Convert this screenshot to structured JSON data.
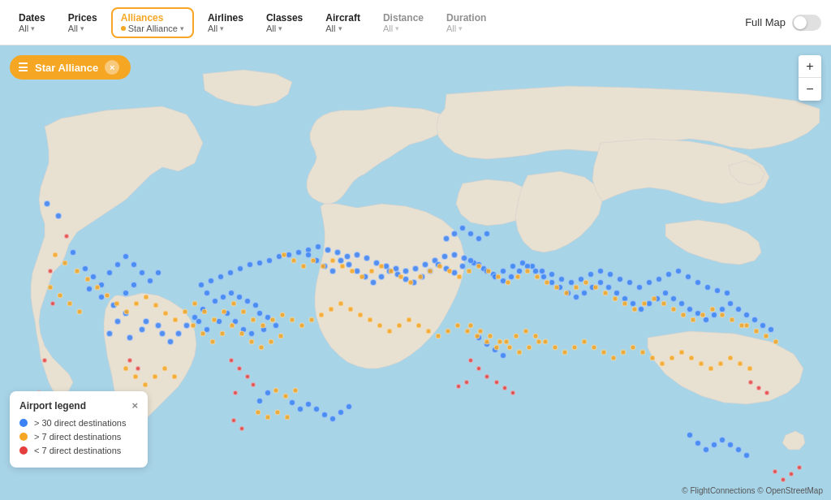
{
  "header": {
    "filters": [
      {
        "id": "dates",
        "label": "Dates",
        "value": "All",
        "active": false
      },
      {
        "id": "prices",
        "label": "Prices",
        "value": "All",
        "active": false
      },
      {
        "id": "alliances",
        "label": "Alliances",
        "value": "Star Alliance",
        "active": true,
        "has_dot": true
      },
      {
        "id": "airlines",
        "label": "Airlines",
        "value": "All",
        "active": false
      },
      {
        "id": "classes",
        "label": "Classes",
        "value": "All",
        "active": false
      },
      {
        "id": "aircraft",
        "label": "Aircraft",
        "value": "All",
        "active": false
      },
      {
        "id": "distance",
        "label": "Distance",
        "value": "All",
        "active": false,
        "muted": true
      },
      {
        "id": "duration",
        "label": "Duration",
        "value": "All",
        "active": false,
        "muted": true
      }
    ],
    "fullmap_label": "Full Map"
  },
  "filter_chip": {
    "label": "Star Alliance",
    "close_label": "×"
  },
  "zoom": {
    "plus": "+",
    "minus": "−"
  },
  "legend": {
    "title": "Airport legend",
    "close": "×",
    "items": [
      {
        "color": "#3b82f6",
        "text": "> 30 direct destinations"
      },
      {
        "color": "#f5a623",
        "text": "> 7 direct destinations"
      },
      {
        "color": "#e53e3e",
        "text": "< 7 direct destinations"
      }
    ]
  },
  "attribution": "© FlightConnections © OpenStreetMap",
  "dots": {
    "blue": [
      [
        72,
        210
      ],
      [
        58,
        195
      ],
      [
        90,
        255
      ],
      [
        110,
        300
      ],
      [
        125,
        310
      ],
      [
        140,
        320
      ],
      [
        155,
        305
      ],
      [
        165,
        295
      ],
      [
        155,
        330
      ],
      [
        145,
        340
      ],
      [
        135,
        355
      ],
      [
        160,
        360
      ],
      [
        175,
        350
      ],
      [
        180,
        340
      ],
      [
        195,
        345
      ],
      [
        200,
        355
      ],
      [
        210,
        365
      ],
      [
        220,
        355
      ],
      [
        230,
        345
      ],
      [
        240,
        335
      ],
      [
        250,
        325
      ],
      [
        245,
        340
      ],
      [
        255,
        350
      ],
      [
        270,
        340
      ],
      [
        280,
        330
      ],
      [
        290,
        340
      ],
      [
        300,
        350
      ],
      [
        310,
        355
      ],
      [
        325,
        350
      ],
      [
        340,
        345
      ],
      [
        330,
        335
      ],
      [
        320,
        330
      ],
      [
        315,
        320
      ],
      [
        305,
        315
      ],
      [
        295,
        310
      ],
      [
        285,
        305
      ],
      [
        275,
        310
      ],
      [
        265,
        315
      ],
      [
        255,
        305
      ],
      [
        248,
        295
      ],
      [
        260,
        290
      ],
      [
        272,
        285
      ],
      [
        284,
        280
      ],
      [
        296,
        275
      ],
      [
        308,
        270
      ],
      [
        320,
        268
      ],
      [
        332,
        265
      ],
      [
        344,
        260
      ],
      [
        356,
        258
      ],
      [
        368,
        255
      ],
      [
        380,
        252
      ],
      [
        392,
        248
      ],
      [
        404,
        252
      ],
      [
        416,
        255
      ],
      [
        428,
        260
      ],
      [
        440,
        258
      ],
      [
        452,
        262
      ],
      [
        464,
        268
      ],
      [
        476,
        272
      ],
      [
        488,
        275
      ],
      [
        500,
        278
      ],
      [
        512,
        275
      ],
      [
        524,
        270
      ],
      [
        536,
        265
      ],
      [
        548,
        260
      ],
      [
        560,
        258
      ],
      [
        572,
        262
      ],
      [
        584,
        268
      ],
      [
        596,
        275
      ],
      [
        608,
        282
      ],
      [
        620,
        278
      ],
      [
        632,
        272
      ],
      [
        644,
        268
      ],
      [
        656,
        272
      ],
      [
        668,
        278
      ],
      [
        680,
        282
      ],
      [
        692,
        288
      ],
      [
        704,
        292
      ],
      [
        716,
        288
      ],
      [
        728,
        282
      ],
      [
        740,
        278
      ],
      [
        752,
        282
      ],
      [
        764,
        288
      ],
      [
        776,
        292
      ],
      [
        788,
        298
      ],
      [
        800,
        292
      ],
      [
        812,
        288
      ],
      [
        824,
        282
      ],
      [
        836,
        278
      ],
      [
        848,
        285
      ],
      [
        860,
        292
      ],
      [
        872,
        298
      ],
      [
        884,
        302
      ],
      [
        896,
        305
      ],
      [
        380,
        258
      ],
      [
        390,
        265
      ],
      [
        400,
        272
      ],
      [
        410,
        278
      ],
      [
        420,
        265
      ],
      [
        430,
        270
      ],
      [
        440,
        278
      ],
      [
        450,
        285
      ],
      [
        460,
        292
      ],
      [
        470,
        285
      ],
      [
        480,
        278
      ],
      [
        490,
        282
      ],
      [
        500,
        288
      ],
      [
        510,
        292
      ],
      [
        520,
        285
      ],
      [
        530,
        278
      ],
      [
        540,
        270
      ],
      [
        550,
        275
      ],
      [
        560,
        280
      ],
      [
        570,
        272
      ],
      [
        580,
        265
      ],
      [
        590,
        270
      ],
      [
        600,
        278
      ],
      [
        610,
        285
      ],
      [
        620,
        290
      ],
      [
        630,
        285
      ],
      [
        640,
        278
      ],
      [
        650,
        272
      ],
      [
        660,
        278
      ],
      [
        670,
        285
      ],
      [
        680,
        292
      ],
      [
        690,
        298
      ],
      [
        700,
        305
      ],
      [
        710,
        310
      ],
      [
        720,
        305
      ],
      [
        730,
        298
      ],
      [
        740,
        292
      ],
      [
        750,
        298
      ],
      [
        760,
        305
      ],
      [
        770,
        312
      ],
      [
        780,
        318
      ],
      [
        790,
        325
      ],
      [
        800,
        318
      ],
      [
        810,
        312
      ],
      [
        820,
        305
      ],
      [
        830,
        312
      ],
      [
        840,
        318
      ],
      [
        850,
        325
      ],
      [
        860,
        330
      ],
      [
        870,
        338
      ],
      [
        880,
        332
      ],
      [
        890,
        325
      ],
      [
        900,
        318
      ],
      [
        910,
        325
      ],
      [
        920,
        332
      ],
      [
        930,
        338
      ],
      [
        940,
        345
      ],
      [
        950,
        350
      ],
      [
        590,
        360
      ],
      [
        600,
        368
      ],
      [
        610,
        375
      ],
      [
        620,
        382
      ],
      [
        330,
        428
      ],
      [
        320,
        438
      ],
      [
        360,
        440
      ],
      [
        370,
        448
      ],
      [
        380,
        442
      ],
      [
        390,
        448
      ],
      [
        400,
        455
      ],
      [
        410,
        460
      ],
      [
        420,
        452
      ],
      [
        430,
        445
      ],
      [
        105,
        275
      ],
      [
        115,
        285
      ],
      [
        125,
        295
      ],
      [
        135,
        280
      ],
      [
        145,
        270
      ],
      [
        155,
        260
      ],
      [
        165,
        270
      ],
      [
        175,
        280
      ],
      [
        185,
        290
      ],
      [
        195,
        280
      ],
      [
        850,
        480
      ],
      [
        860,
        490
      ],
      [
        870,
        498
      ],
      [
        880,
        492
      ],
      [
        890,
        486
      ],
      [
        900,
        492
      ],
      [
        910,
        498
      ],
      [
        920,
        505
      ],
      [
        550,
        238
      ],
      [
        560,
        232
      ],
      [
        570,
        225
      ],
      [
        580,
        232
      ],
      [
        590,
        238
      ],
      [
        600,
        232
      ]
    ],
    "orange": [
      [
        68,
        258
      ],
      [
        80,
        268
      ],
      [
        95,
        278
      ],
      [
        108,
        288
      ],
      [
        120,
        298
      ],
      [
        132,
        308
      ],
      [
        144,
        318
      ],
      [
        156,
        328
      ],
      [
        168,
        318
      ],
      [
        180,
        310
      ],
      [
        192,
        320
      ],
      [
        204,
        330
      ],
      [
        216,
        338
      ],
      [
        228,
        328
      ],
      [
        240,
        318
      ],
      [
        252,
        328
      ],
      [
        264,
        338
      ],
      [
        276,
        328
      ],
      [
        288,
        318
      ],
      [
        300,
        328
      ],
      [
        312,
        338
      ],
      [
        324,
        345
      ],
      [
        336,
        338
      ],
      [
        348,
        332
      ],
      [
        360,
        338
      ],
      [
        372,
        345
      ],
      [
        384,
        338
      ],
      [
        396,
        332
      ],
      [
        408,
        325
      ],
      [
        420,
        318
      ],
      [
        432,
        325
      ],
      [
        444,
        332
      ],
      [
        456,
        338
      ],
      [
        468,
        345
      ],
      [
        480,
        352
      ],
      [
        492,
        345
      ],
      [
        504,
        338
      ],
      [
        516,
        345
      ],
      [
        528,
        352
      ],
      [
        540,
        358
      ],
      [
        552,
        352
      ],
      [
        564,
        345
      ],
      [
        576,
        352
      ],
      [
        588,
        358
      ],
      [
        600,
        365
      ],
      [
        612,
        372
      ],
      [
        624,
        365
      ],
      [
        636,
        358
      ],
      [
        648,
        352
      ],
      [
        660,
        358
      ],
      [
        672,
        365
      ],
      [
        684,
        372
      ],
      [
        696,
        378
      ],
      [
        708,
        372
      ],
      [
        720,
        365
      ],
      [
        732,
        372
      ],
      [
        744,
        378
      ],
      [
        756,
        385
      ],
      [
        768,
        378
      ],
      [
        780,
        372
      ],
      [
        792,
        378
      ],
      [
        804,
        385
      ],
      [
        816,
        392
      ],
      [
        828,
        385
      ],
      [
        840,
        378
      ],
      [
        852,
        385
      ],
      [
        864,
        392
      ],
      [
        876,
        398
      ],
      [
        888,
        392
      ],
      [
        900,
        385
      ],
      [
        912,
        392
      ],
      [
        924,
        398
      ],
      [
        350,
        258
      ],
      [
        362,
        265
      ],
      [
        374,
        272
      ],
      [
        386,
        265
      ],
      [
        398,
        272
      ],
      [
        410,
        265
      ],
      [
        422,
        272
      ],
      [
        434,
        278
      ],
      [
        446,
        285
      ],
      [
        458,
        278
      ],
      [
        470,
        272
      ],
      [
        482,
        278
      ],
      [
        494,
        285
      ],
      [
        506,
        292
      ],
      [
        518,
        285
      ],
      [
        530,
        278
      ],
      [
        542,
        272
      ],
      [
        554,
        278
      ],
      [
        566,
        285
      ],
      [
        578,
        278
      ],
      [
        590,
        272
      ],
      [
        602,
        278
      ],
      [
        614,
        285
      ],
      [
        626,
        292
      ],
      [
        638,
        285
      ],
      [
        650,
        278
      ],
      [
        662,
        285
      ],
      [
        674,
        292
      ],
      [
        686,
        298
      ],
      [
        698,
        305
      ],
      [
        710,
        298
      ],
      [
        722,
        292
      ],
      [
        734,
        298
      ],
      [
        746,
        305
      ],
      [
        758,
        312
      ],
      [
        770,
        318
      ],
      [
        782,
        325
      ],
      [
        794,
        318
      ],
      [
        806,
        312
      ],
      [
        818,
        318
      ],
      [
        830,
        325
      ],
      [
        842,
        332
      ],
      [
        854,
        338
      ],
      [
        866,
        332
      ],
      [
        878,
        325
      ],
      [
        890,
        332
      ],
      [
        902,
        338
      ],
      [
        914,
        345
      ],
      [
        62,
        298
      ],
      [
        74,
        308
      ],
      [
        86,
        318
      ],
      [
        98,
        328
      ],
      [
        238,
        345
      ],
      [
        250,
        355
      ],
      [
        262,
        365
      ],
      [
        274,
        355
      ],
      [
        286,
        345
      ],
      [
        298,
        355
      ],
      [
        310,
        365
      ],
      [
        322,
        372
      ],
      [
        334,
        365
      ],
      [
        346,
        358
      ],
      [
        155,
        398
      ],
      [
        167,
        408
      ],
      [
        179,
        418
      ],
      [
        191,
        408
      ],
      [
        203,
        398
      ],
      [
        215,
        408
      ],
      [
        318,
        452
      ],
      [
        330,
        458
      ],
      [
        342,
        452
      ],
      [
        354,
        458
      ],
      [
        920,
        345
      ],
      [
        932,
        352
      ],
      [
        944,
        358
      ],
      [
        956,
        365
      ],
      [
        580,
        345
      ],
      [
        592,
        352
      ],
      [
        604,
        358
      ],
      [
        616,
        365
      ],
      [
        628,
        372
      ],
      [
        640,
        378
      ],
      [
        652,
        372
      ],
      [
        664,
        365
      ],
      [
        340,
        425
      ],
      [
        352,
        432
      ],
      [
        364,
        425
      ]
    ],
    "red": [
      [
        82,
        235
      ],
      [
        62,
        278
      ],
      [
        55,
        388
      ],
      [
        48,
        428
      ],
      [
        45,
        498
      ],
      [
        58,
        508
      ],
      [
        285,
        388
      ],
      [
        295,
        398
      ],
      [
        305,
        408
      ],
      [
        312,
        418
      ],
      [
        290,
        428
      ],
      [
        580,
        388
      ],
      [
        590,
        398
      ],
      [
        600,
        408
      ],
      [
        612,
        415
      ],
      [
        622,
        422
      ],
      [
        632,
        428
      ],
      [
        575,
        415
      ],
      [
        565,
        420
      ],
      [
        955,
        525
      ],
      [
        965,
        535
      ],
      [
        975,
        528
      ],
      [
        985,
        520
      ],
      [
        925,
        415
      ],
      [
        935,
        422
      ],
      [
        945,
        428
      ],
      [
        288,
        462
      ],
      [
        298,
        472
      ],
      [
        160,
        388
      ],
      [
        170,
        398
      ],
      [
        65,
        318
      ]
    ]
  }
}
